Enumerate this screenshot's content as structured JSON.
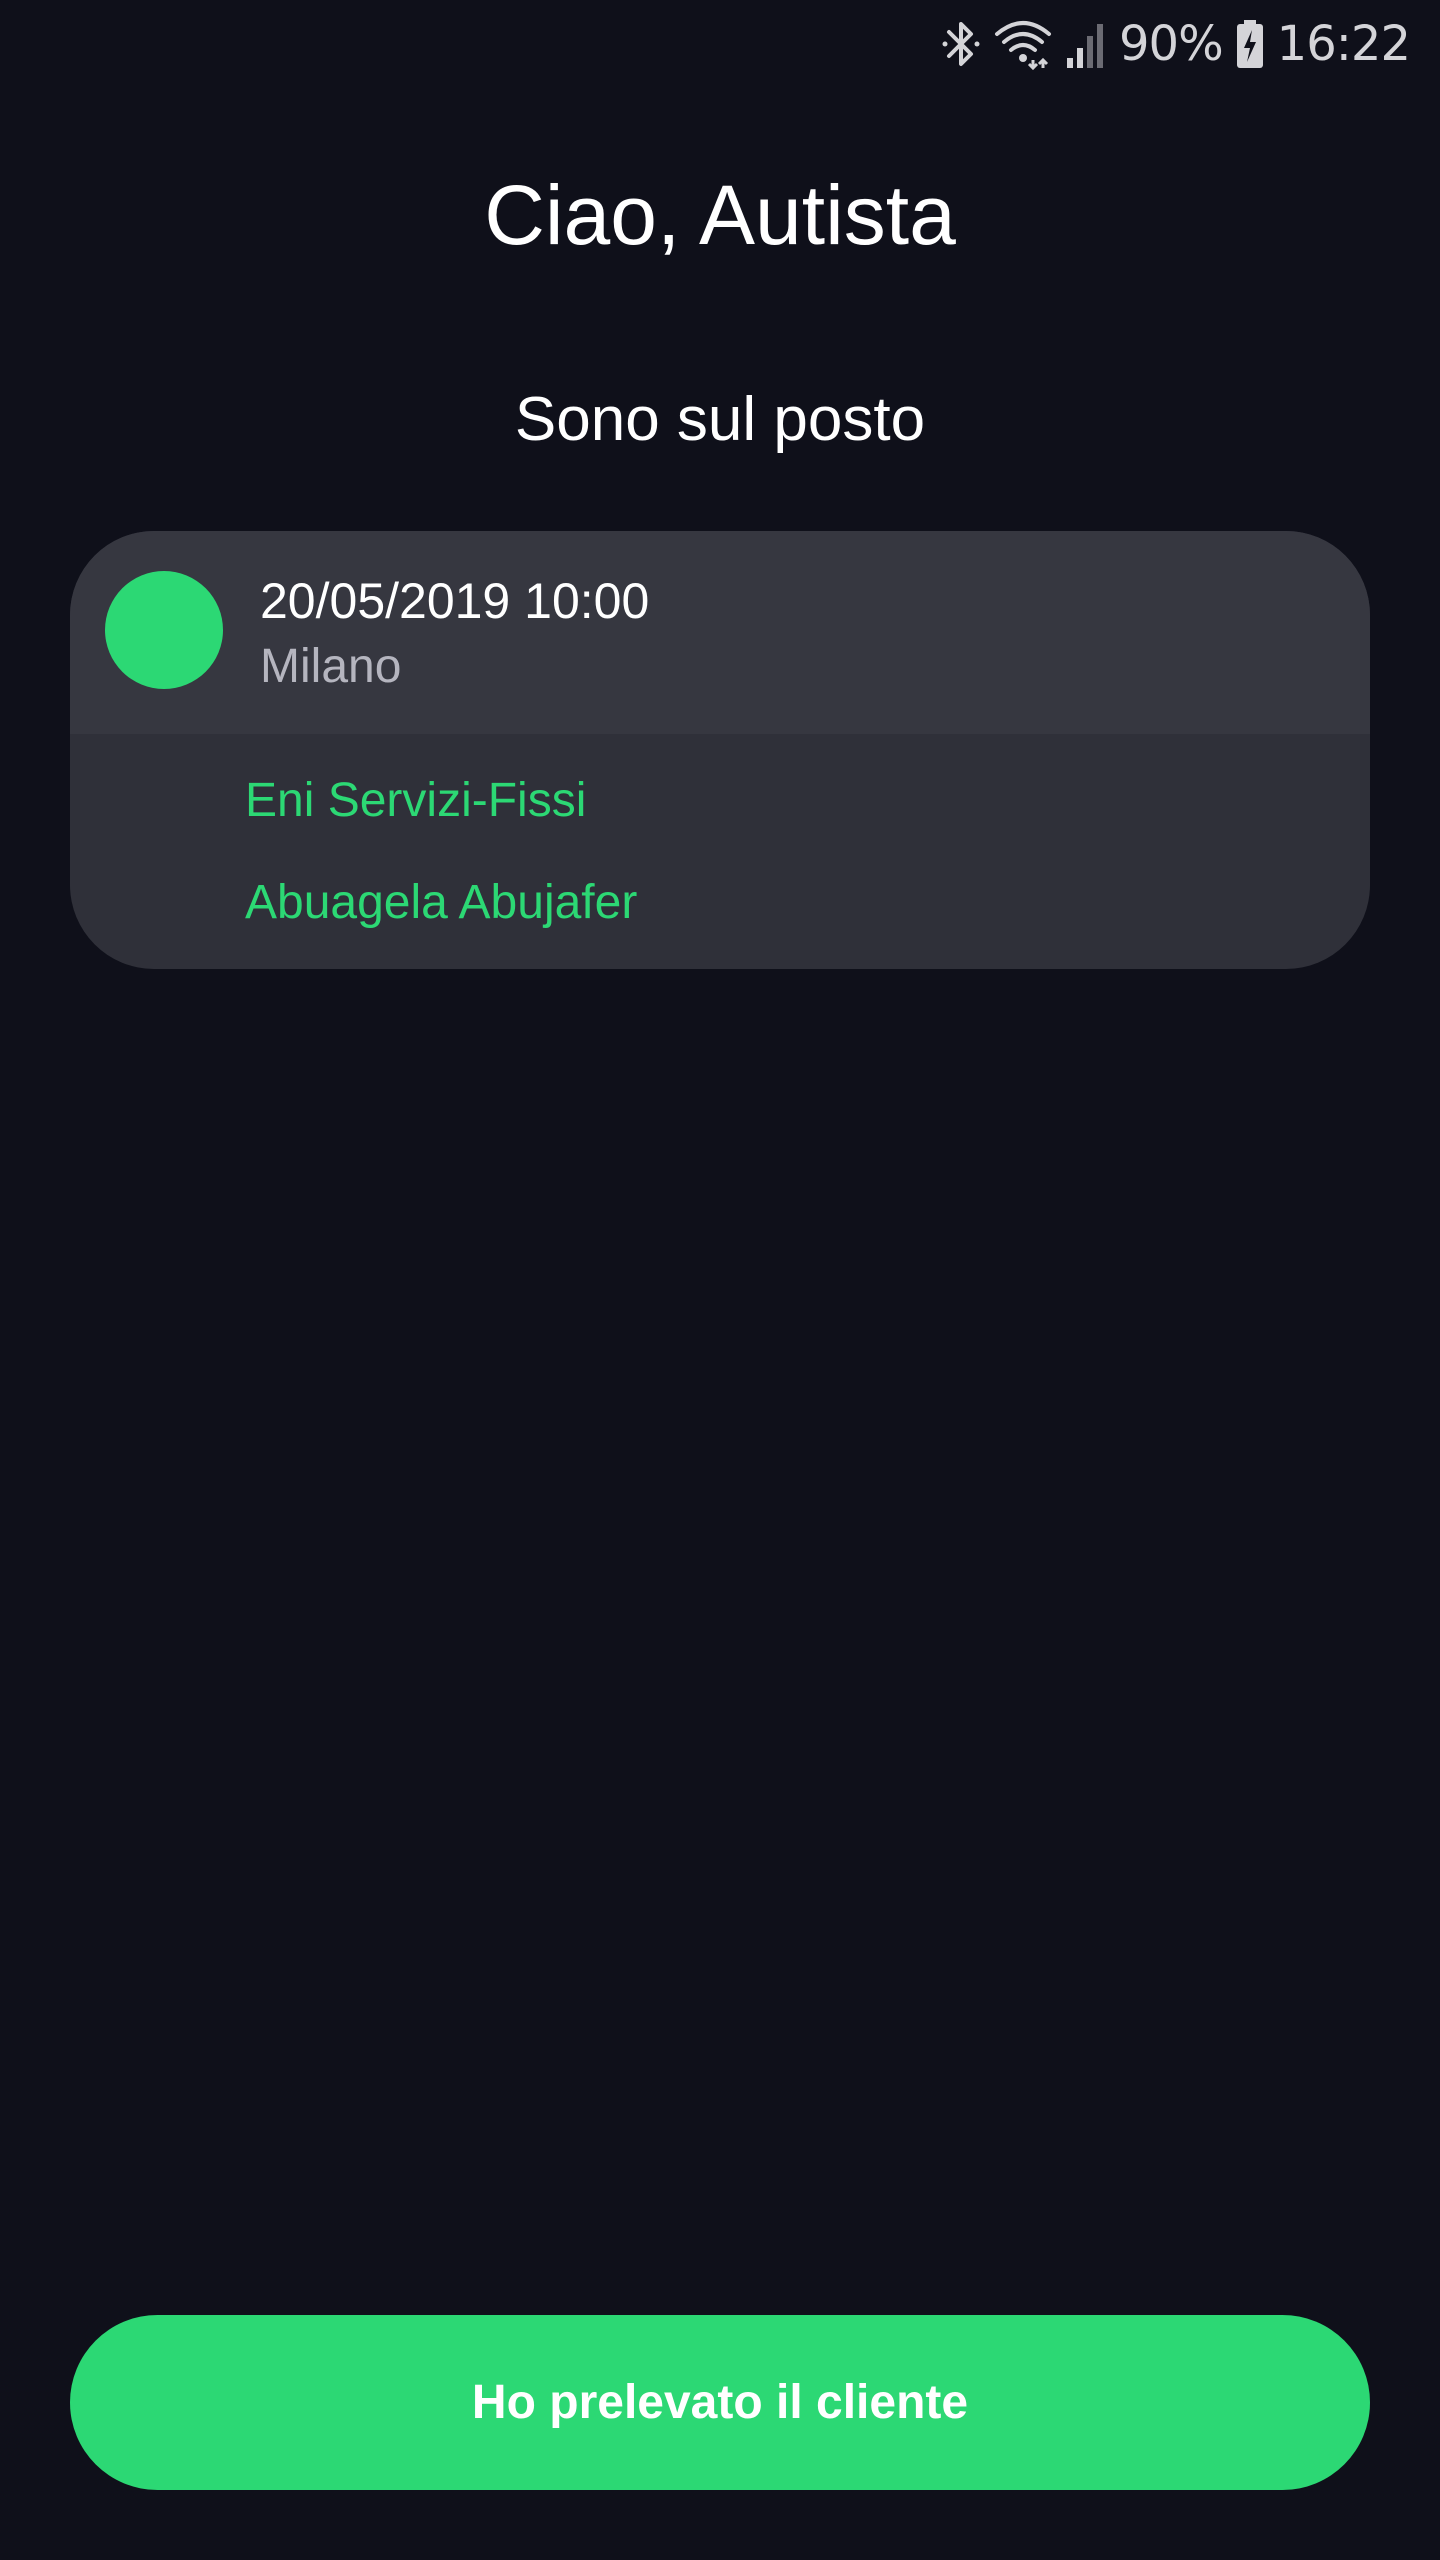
{
  "status_bar": {
    "battery_percent": "90%",
    "time": "16:22",
    "icons": [
      "bluetooth-icon",
      "wifi-icon",
      "signal-icon",
      "battery-charging-icon"
    ]
  },
  "greeting": "Ciao, Autista",
  "ride_status": "Sono sul posto",
  "ride": {
    "datetime": "20/05/2019 10:00",
    "city": "Milano",
    "company": "Eni Servizi-Fissi",
    "customer": "Abuagela Abujafer",
    "status_color": "#2cd874"
  },
  "actions": {
    "pickup_label": "Ho prelevato il cliente"
  },
  "colors": {
    "background": "#0f101a",
    "card": "#2f3039",
    "card_header": "#363740",
    "accent": "#2cd874"
  }
}
